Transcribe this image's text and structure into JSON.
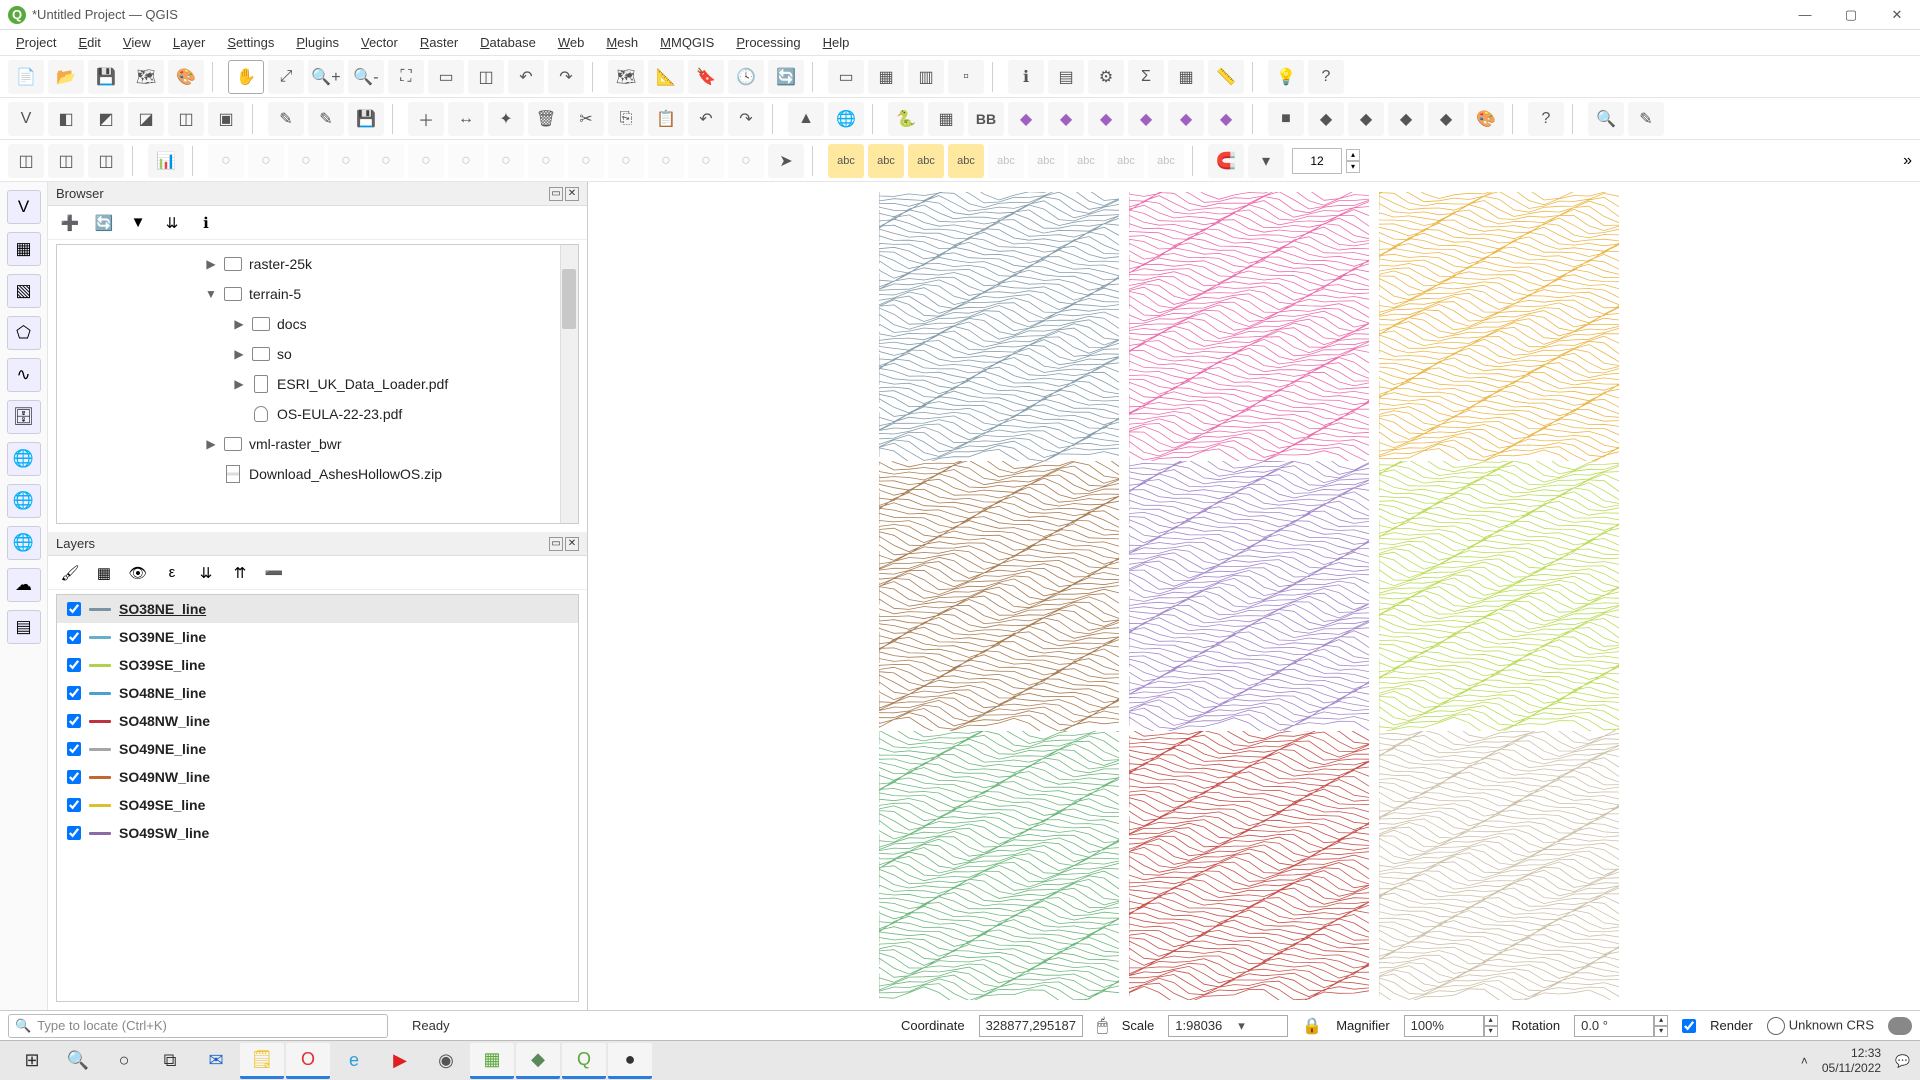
{
  "window": {
    "title": "*Untitled Project — QGIS"
  },
  "menu": [
    "Project",
    "Edit",
    "View",
    "Layer",
    "Settings",
    "Plugins",
    "Vector",
    "Raster",
    "Database",
    "Web",
    "Mesh",
    "MMQGIS",
    "Processing",
    "Help"
  ],
  "toolbar1_icons": [
    "new-project",
    "open-project",
    "save-project",
    "layout-manager",
    "style-manager",
    "sep",
    "pan",
    "pan-to-selection",
    "zoom-in",
    "zoom-out",
    "zoom-full",
    "zoom-selection",
    "zoom-layer",
    "zoom-last",
    "zoom-next",
    "sep",
    "new-map-view",
    "new-3d-view",
    "new-bookmark",
    "temporal",
    "refresh",
    "sep",
    "select",
    "select-form",
    "select-value",
    "deselect",
    "sep",
    "identify",
    "open-attr-table",
    "field-calc",
    "stats",
    "open-table",
    "measure",
    "sep",
    "tips",
    "help"
  ],
  "toolbar2_icons": [
    "new-vector",
    "new-geopackage",
    "new-shapefile",
    "new-spatialite",
    "new-virtual",
    "new-memory",
    "sep",
    "toggle-edit",
    "save-edits",
    "save-all-edits",
    "sep",
    "add-feature",
    "move-feature",
    "node-tool",
    "delete",
    "cut",
    "copy",
    "paste",
    "undo",
    "redo",
    "sep",
    "triangle",
    "globe",
    "sep",
    "python",
    "table",
    "bb",
    "purple1",
    "purple2",
    "purple3",
    "purple4",
    "purple5",
    "pink",
    "sep",
    "black",
    "yellow",
    "green1",
    "green2",
    "green3",
    "palette",
    "sep",
    "help2",
    "sep",
    "search-osm",
    "edit-osm"
  ],
  "toolbar3_icons": [
    "g1",
    "g2",
    "g3",
    "sep",
    "chart",
    "sep",
    "d1",
    "d2",
    "d3",
    "d4",
    "d5",
    "d6",
    "d7",
    "d8",
    "d9",
    "d10",
    "d11",
    "d12",
    "d13",
    "d14",
    "arrow",
    "sep",
    "label1",
    "label2",
    "label3",
    "label4",
    "l5",
    "l6",
    "l7",
    "l8",
    "l9",
    "sep",
    "magnet",
    "snapopts"
  ],
  "toolbar3_number": "12",
  "vtoolbar": [
    "edit-line",
    "grid",
    "layer-vec",
    "poly",
    "curve",
    "db",
    "globe",
    "wms",
    "wfs",
    "cloud",
    "table2"
  ],
  "browser": {
    "title": "Browser",
    "toolbar": [
      "add",
      "refresh",
      "filter",
      "collapse",
      "info"
    ],
    "tree": [
      {
        "indent": 1,
        "arrow": "▶",
        "icon": "folder",
        "label": "raster-25k"
      },
      {
        "indent": 1,
        "arrow": "▼",
        "icon": "folder",
        "label": "terrain-5"
      },
      {
        "indent": 2,
        "arrow": "▶",
        "icon": "folder",
        "label": "docs"
      },
      {
        "indent": 2,
        "arrow": "▶",
        "icon": "folder",
        "label": "so"
      },
      {
        "indent": 2,
        "arrow": "▶",
        "icon": "file",
        "label": "ESRI_UK_Data_Loader.pdf"
      },
      {
        "indent": 2,
        "arrow": "",
        "icon": "db",
        "label": "OS-EULA-22-23.pdf"
      },
      {
        "indent": 1,
        "arrow": "▶",
        "icon": "folder",
        "label": "vml-raster_bwr"
      },
      {
        "indent": 1,
        "arrow": "",
        "icon": "zip",
        "label": "Download_AshesHollowOS.zip"
      }
    ]
  },
  "layers_panel": {
    "title": "Layers",
    "toolbar": [
      "style",
      "add-group",
      "filter-legend",
      "expr",
      "expand",
      "collapse",
      "remove"
    ],
    "layers": [
      {
        "name": "SO38NE_line",
        "color": "#7a94a3",
        "checked": true,
        "active": true
      },
      {
        "name": "SO39NE_line",
        "color": "#67b0c9",
        "checked": true
      },
      {
        "name": "SO39SE_line",
        "color": "#b0d050",
        "checked": true
      },
      {
        "name": "SO48NE_line",
        "color": "#4aa0d0",
        "checked": true
      },
      {
        "name": "SO48NW_line",
        "color": "#c03040",
        "checked": true
      },
      {
        "name": "SO49NE_line",
        "color": "#a6a6a6",
        "checked": true
      },
      {
        "name": "SO49NW_line",
        "color": "#c06830",
        "checked": true
      },
      {
        "name": "SO49SE_line",
        "color": "#d8c030",
        "checked": true
      },
      {
        "name": "SO49SW_line",
        "color": "#8a6aa8",
        "checked": true
      }
    ]
  },
  "canvas_tiles": [
    {
      "row": 0,
      "col": 0,
      "color": "#7a94a3"
    },
    {
      "row": 0,
      "col": 1,
      "color": "#e85fa5"
    },
    {
      "row": 0,
      "col": 2,
      "color": "#e8b03a"
    },
    {
      "row": 1,
      "col": 0,
      "color": "#a07043"
    },
    {
      "row": 1,
      "col": 1,
      "color": "#9a7dc5"
    },
    {
      "row": 1,
      "col": 2,
      "color": "#b5d84a"
    },
    {
      "row": 2,
      "col": 0,
      "color": "#5fb070"
    },
    {
      "row": 2,
      "col": 1,
      "color": "#c0403a"
    },
    {
      "row": 2,
      "col": 2,
      "color": "#c8baa0"
    }
  ],
  "status": {
    "search_placeholder": "Type to locate (Ctrl+K)",
    "ready": "Ready",
    "coord_label": "Coordinate",
    "coord_value": "328877,295187",
    "scale_label": "Scale",
    "scale_value": "1:98036",
    "magnifier_label": "Magnifier",
    "magnifier_value": "100%",
    "rotation_label": "Rotation",
    "rotation_value": "0.0 °",
    "render_label": "Render",
    "crs_label": "Unknown CRS"
  },
  "taskbar": {
    "apps": [
      {
        "name": "start",
        "glyph": "⊞",
        "color": "#333"
      },
      {
        "name": "search",
        "glyph": "🔍",
        "color": "#333"
      },
      {
        "name": "cortana",
        "glyph": "○",
        "color": "#333"
      },
      {
        "name": "taskview",
        "glyph": "⧉",
        "color": "#333"
      },
      {
        "name": "outlook",
        "glyph": "✉",
        "color": "#1a62c9",
        "active": false
      },
      {
        "name": "sticky",
        "glyph": "🗒",
        "color": "#f0c020",
        "active": true
      },
      {
        "name": "opera",
        "glyph": "O",
        "color": "#e03030",
        "active": true
      },
      {
        "name": "edge",
        "glyph": "e",
        "color": "#2b9fd8",
        "active": false
      },
      {
        "name": "youtube",
        "glyph": "▶",
        "color": "#e02020"
      },
      {
        "name": "steam",
        "glyph": "◉",
        "color": "#555"
      },
      {
        "name": "libre",
        "glyph": "▦",
        "color": "#5aa83a",
        "active": true
      },
      {
        "name": "app1",
        "glyph": "◆",
        "color": "#5a8a5a",
        "active": true
      },
      {
        "name": "qgis",
        "glyph": "Q",
        "color": "#59a93c",
        "active": true
      },
      {
        "name": "obs",
        "glyph": "●",
        "color": "#333",
        "active": true
      }
    ],
    "time": "12:33",
    "date": "05/11/2022"
  }
}
